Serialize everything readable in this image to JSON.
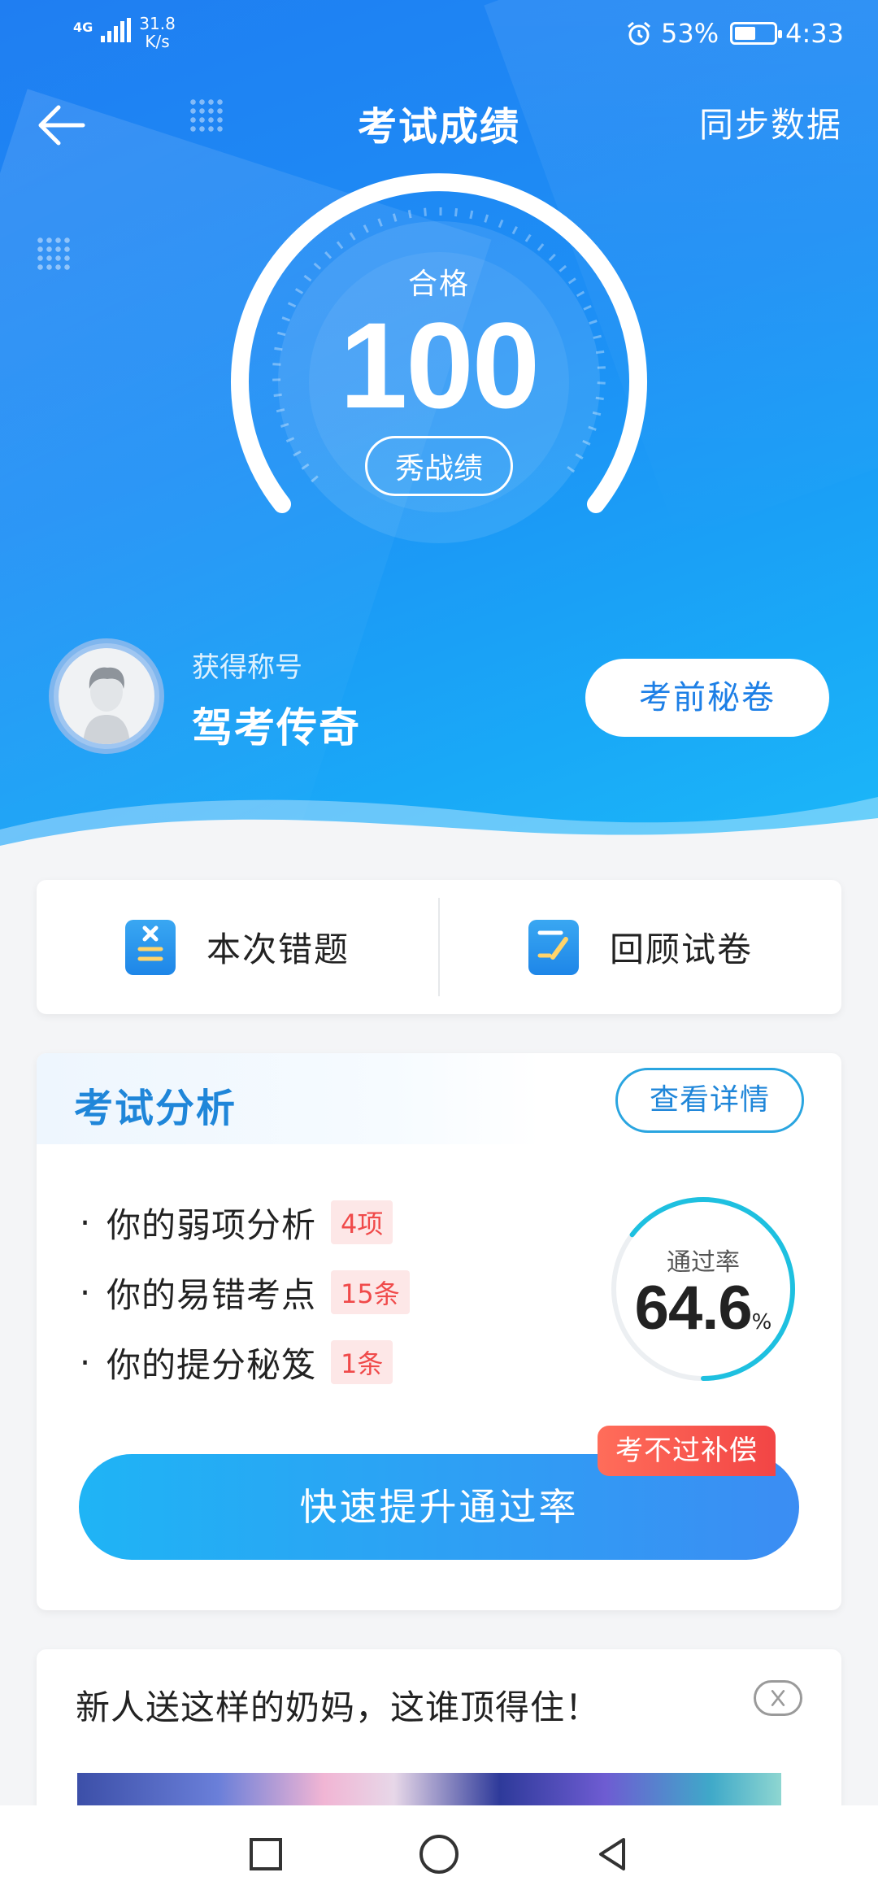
{
  "status_bar": {
    "network": "4G",
    "speed_value": "31.8",
    "speed_unit": "K/s",
    "battery_percent": "53%",
    "battery_level": 0.53,
    "time": "4:33"
  },
  "nav": {
    "title": "考试成绩",
    "sync_label": "同步数据"
  },
  "score": {
    "result_label": "合格",
    "value": "100",
    "share_label": "秀战绩"
  },
  "profile": {
    "title_caption": "获得称号",
    "title_name": "驾考传奇",
    "secret_button": "考前秘卷"
  },
  "actions": {
    "wrong_questions": "本次错题",
    "review_paper": "回顾试卷"
  },
  "analysis": {
    "title": "考试分析",
    "detail_button": "查看详情",
    "items": [
      {
        "label": "你的弱项分析",
        "badge": "4项"
      },
      {
        "label": "你的易错考点",
        "badge": "15条"
      },
      {
        "label": "你的提分秘笈",
        "badge": "1条"
      }
    ],
    "pass_rate_label": "通过率",
    "pass_rate_value": "64.6",
    "pass_rate_unit": "%",
    "pass_rate_fraction": 0.646,
    "cta_label": "快速提升通过率",
    "cta_tag": "考不过补偿"
  },
  "ad": {
    "text": "新人送这样的奶妈，这谁顶得住！"
  },
  "colors": {
    "brand_blue": "#1f86d9",
    "badge_red": "#f04a4a",
    "ring_cyan": "#1ec0e0"
  }
}
